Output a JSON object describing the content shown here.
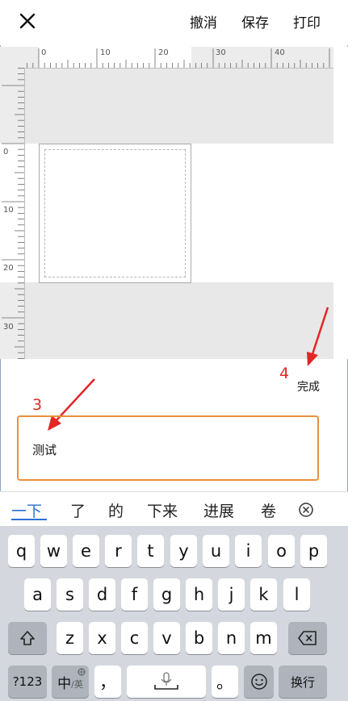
{
  "topbar": {
    "actions": {
      "undo": "撤消",
      "save": "保存",
      "print": "打印"
    }
  },
  "ruler": {
    "top_labels": [
      "0",
      "10",
      "20",
      "30",
      "40"
    ],
    "left_labels": [
      "0",
      "10",
      "20",
      "30"
    ]
  },
  "editor": {
    "done_label": "完成",
    "input_value": "测试"
  },
  "annotations": {
    "step3": "3",
    "step4": "4"
  },
  "candidates": [
    "一下",
    "了",
    "的",
    "下来",
    "进展",
    "卷"
  ],
  "keyboard": {
    "row1": [
      "q",
      "w",
      "e",
      "r",
      "t",
      "y",
      "u",
      "i",
      "o",
      "p"
    ],
    "row2": [
      "a",
      "s",
      "d",
      "f",
      "g",
      "h",
      "j",
      "k",
      "l"
    ],
    "row3": [
      "z",
      "x",
      "c",
      "v",
      "b",
      "n",
      "m"
    ],
    "num_key": "?123",
    "lang_key_main": "中",
    "lang_key_sub": "/英",
    "comma": "，",
    "period": "。",
    "enter_key": "换行"
  },
  "colors": {
    "accent": "#2a6fd6",
    "focus_border": "#e8913a",
    "annotation": "#e32626"
  }
}
